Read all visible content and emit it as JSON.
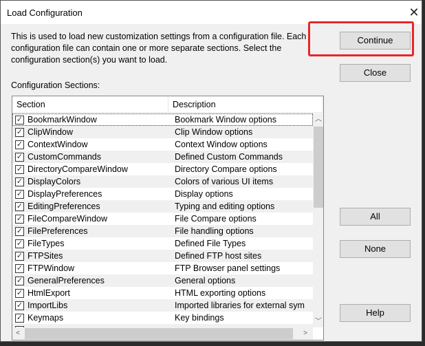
{
  "window": {
    "title": "Load Configuration"
  },
  "intro": "This is used to load new customization settings from a configuration file. Each configuration file can contain one or more separate sections. Select the configuration section(s) you want to load.",
  "sections_label": "Configuration Sections:",
  "buttons": {
    "continue": "Continue",
    "close": "Close",
    "all": "All",
    "none": "None",
    "help": "Help"
  },
  "highlight_color": "#e8262a",
  "table": {
    "columns": [
      "Section",
      "Description"
    ],
    "rows": [
      {
        "section": "BookmarkWindow",
        "description": "Bookmark Window options",
        "checked": true
      },
      {
        "section": "ClipWindow",
        "description": "Clip Window options",
        "checked": true
      },
      {
        "section": "ContextWindow",
        "description": "Context Window options",
        "checked": true
      },
      {
        "section": "CustomCommands",
        "description": "Defined Custom Commands",
        "checked": true
      },
      {
        "section": "DirectoryCompareWindow",
        "description": "Directory Compare options",
        "checked": true
      },
      {
        "section": "DisplayColors",
        "description": "Colors of various UI items",
        "checked": true
      },
      {
        "section": "DisplayPreferences",
        "description": "Display options",
        "checked": true
      },
      {
        "section": "EditingPreferences",
        "description": "Typing and editing options",
        "checked": true
      },
      {
        "section": "FileCompareWindow",
        "description": "File Compare options",
        "checked": true
      },
      {
        "section": "FilePreferences",
        "description": "File handling options",
        "checked": true
      },
      {
        "section": "FileTypes",
        "description": "Defined File Types",
        "checked": true
      },
      {
        "section": "FTPSites",
        "description": "Defined FTP host sites",
        "checked": true
      },
      {
        "section": "FTPWindow",
        "description": "FTP Browser panel settings",
        "checked": true
      },
      {
        "section": "GeneralPreferences",
        "description": "General options",
        "checked": true
      },
      {
        "section": "HtmlExport",
        "description": "HTML exporting options",
        "checked": true
      },
      {
        "section": "ImportLibs",
        "description": "Imported libraries for external sym",
        "checked": true
      },
      {
        "section": "Keymaps",
        "description": "Key bindings",
        "checked": true
      },
      {
        "section": "",
        "description": "",
        "checked": true
      }
    ]
  }
}
